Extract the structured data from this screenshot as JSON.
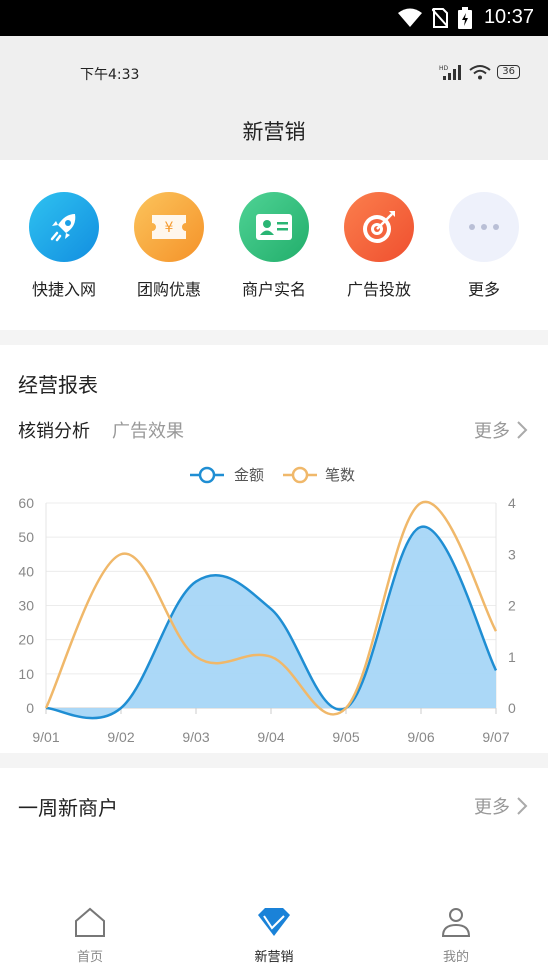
{
  "system": {
    "time": "10:37"
  },
  "app_status": {
    "time": "下午4:33",
    "battery": "36"
  },
  "nav": {
    "title": "新营销"
  },
  "quick": [
    {
      "label": "快捷入网",
      "icon": "rocket-icon",
      "color": "#18a8e6"
    },
    {
      "label": "团购优惠",
      "icon": "coupon-icon",
      "color": "#f7a43b"
    },
    {
      "label": "商户实名",
      "icon": "id-card-icon",
      "color": "#35c17f"
    },
    {
      "label": "广告投放",
      "icon": "target-icon",
      "color": "#f4643e"
    },
    {
      "label": "更多",
      "icon": "more-dots-icon",
      "color": "#eef1fb"
    }
  ],
  "report": {
    "heading": "经营报表",
    "tabs": [
      "核销分析",
      "广告效果"
    ],
    "more": "更多"
  },
  "weekly": {
    "heading": "一周新商户",
    "more": "更多"
  },
  "tabbar": [
    {
      "label": "首页",
      "icon": "home-icon"
    },
    {
      "label": "新营销",
      "icon": "marketing-diamond-icon"
    },
    {
      "label": "我的",
      "icon": "user-icon"
    }
  ],
  "chart_data": {
    "type": "line",
    "categories": [
      "9/01",
      "9/02",
      "9/03",
      "9/04",
      "9/05",
      "9/06",
      "9/07"
    ],
    "series": [
      {
        "name": "金额",
        "values": [
          0,
          0,
          37,
          29,
          0,
          53,
          11
        ],
        "axis": "left",
        "color": "#1f8ed3",
        "fill": "#a6d6f7"
      },
      {
        "name": "笔数",
        "values": [
          0,
          3,
          1,
          1,
          0,
          4,
          1.5
        ],
        "axis": "right",
        "color": "#f0b86a"
      }
    ],
    "ylim_left": [
      0,
      60
    ],
    "yticks_left": [
      0,
      10,
      20,
      30,
      40,
      50,
      60
    ],
    "ylim_right": [
      0,
      4
    ],
    "yticks_right": [
      0,
      1,
      2,
      3,
      4
    ],
    "legend": "top-center",
    "grid": true,
    "smooth": true
  }
}
